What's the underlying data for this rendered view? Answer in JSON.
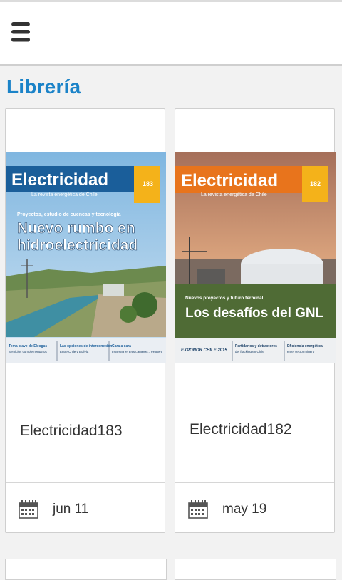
{
  "header": {
    "menu_icon": "hamburger-menu-icon"
  },
  "page": {
    "title": "Librería"
  },
  "colors": {
    "title": "#1b83c8",
    "brand_blue": "#1a6fb6",
    "brand_orange": "#e8741c",
    "issue_badge": "#f4b21a"
  },
  "items": [
    {
      "name": "Electricidad183",
      "date": "jun 11",
      "date_icon": "calendar-icon",
      "cover": {
        "brand": "Electricidad",
        "tagline": "La revista energética de Chile",
        "issue": "183",
        "kicker": "Proyectos, estudio de cuencas y tecnología",
        "headline_1": "Nuevo rumbo en",
        "headline_2": "hidroelectricidad",
        "footer_1_title": "Tema clave de Elecgas",
        "footer_1_text": "Servicios complementarios",
        "footer_2_title": "Las opciones de interconexión",
        "footer_2_text": "Entre Chile y Bolivia",
        "footer_3_title": "Cara a cara",
        "footer_3_text": "Eficiencia en Eras Cardenas – Pelquera"
      }
    },
    {
      "name": "Electricidad182",
      "date": "may 19",
      "date_icon": "calendar-icon",
      "cover": {
        "brand": "Electricidad",
        "tagline": "La revista energética de Chile",
        "issue": "182",
        "kicker": "Nuevos proyectos y futuro terminal",
        "headline_1": "Los desafíos del GNL",
        "footer_logo": "EXPONOR CHILE 2015",
        "footer_2_title": "Partidarios y detractores",
        "footer_2_text": "del fracking en Chile",
        "footer_3_title": "Eficiencia energética",
        "footer_3_text": "en el sector minero"
      }
    }
  ]
}
